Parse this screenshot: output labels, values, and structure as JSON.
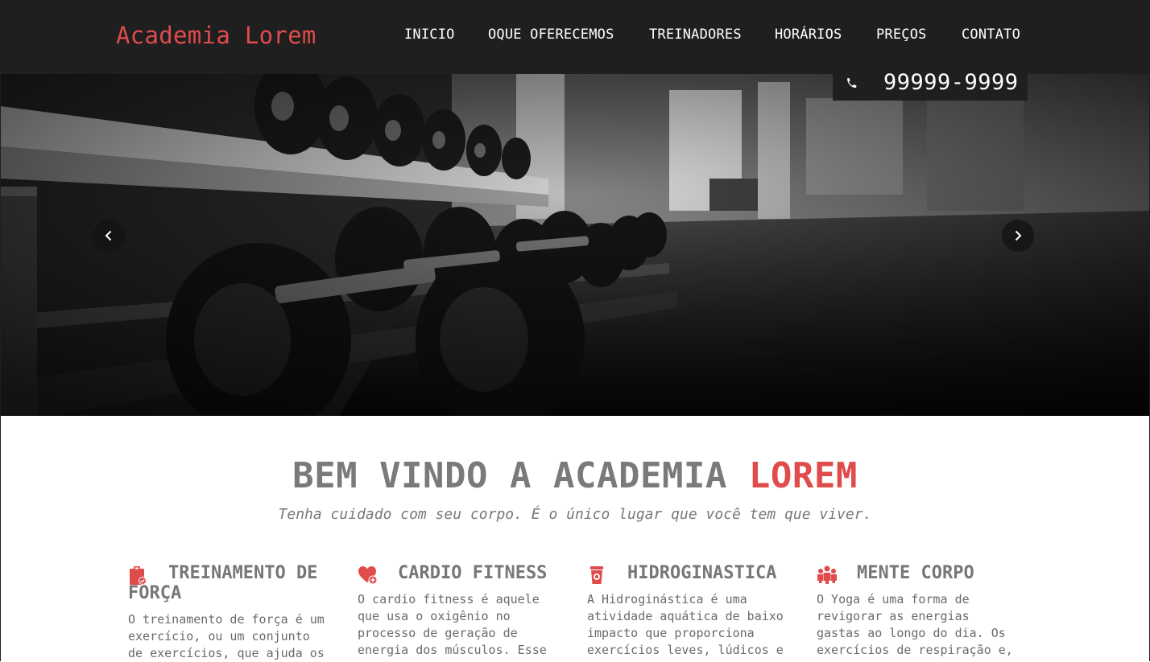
{
  "header": {
    "brand": "Academia Lorem",
    "nav": [
      "INICIO",
      "OQUE OFERECEMOS",
      "TREINADORES",
      "HORÁRIOS",
      "PREÇOS",
      "CONTATO"
    ],
    "phone": "99999-9999"
  },
  "hero": {
    "prev_icon": "chevron-left-icon",
    "next_icon": "chevron-right-icon"
  },
  "welcome": {
    "title_prefix": "BEM VINDO A ACADEMIA",
    "title_accent": "LOREM",
    "subtitle": "Tenha cuidado com seu corpo. É o único lugar que você tem que viver."
  },
  "features": [
    {
      "icon": "clipboard-check-icon",
      "title": "TREINAMENTO DE FORÇA",
      "text": "O treinamento de força é um exercício, ou um conjunto de exercícios, que ajuda os"
    },
    {
      "icon": "heart-plus-icon",
      "title": "CARDIO FITNESS",
      "text": "O cardio fitness é aquele que usa o oxigênio no processo de geração de energia dos músculos. Esse"
    },
    {
      "icon": "cup-icon",
      "title": "HIDROGINASTICA",
      "text": "A Hidroginástica é uma atividade aquática de baixo impacto que proporciona exercícios leves, lúdicos e"
    },
    {
      "icon": "group-icon",
      "title": "MENTE CORPO",
      "text": "O Yoga é uma forma de revigorar as energias gastas ao longo do dia. Os exercícios de respiração e,"
    }
  ],
  "colors": {
    "accent": "#e04b4b",
    "navbar": "#1f1f1f",
    "text": "#777777"
  }
}
